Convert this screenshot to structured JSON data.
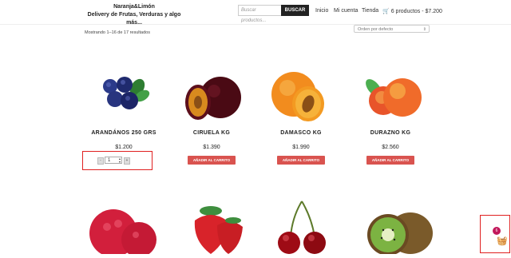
{
  "header": {
    "brand_line1": "Naranja&Limón",
    "brand_line2": "Delivery de Frutas, Verduras y algo más...",
    "search_placeholder": "Buscar productos...",
    "search_button": "BUSCAR",
    "nav": [
      "Inicio",
      "Mi cuenta",
      "Tienda"
    ],
    "cart_label": "6 productos - $7.200"
  },
  "shop": {
    "results": "Mostrando 1–16 de 17 resultados",
    "orderby": "Orden por defecto"
  },
  "products": [
    {
      "title": "ARANDÁNOS 250 GRS",
      "price": "$1.200",
      "quantity": "1"
    },
    {
      "title": "CIRUELA KG",
      "price": "$1.390",
      "button": "AÑADIR AL CARRITO"
    },
    {
      "title": "DAMASCO KG",
      "price": "$1.990",
      "button": "AÑADIR AL CARRITO"
    },
    {
      "title": "DURAZNO KG",
      "price": "$2.560",
      "button": "AÑADIR AL CARRITO"
    }
  ],
  "floating_cart": {
    "count": "6",
    "icon": "basket-icon"
  },
  "colors": {
    "accent": "#d9534f",
    "badge": "#c2185b",
    "highlight": "#e02020"
  }
}
